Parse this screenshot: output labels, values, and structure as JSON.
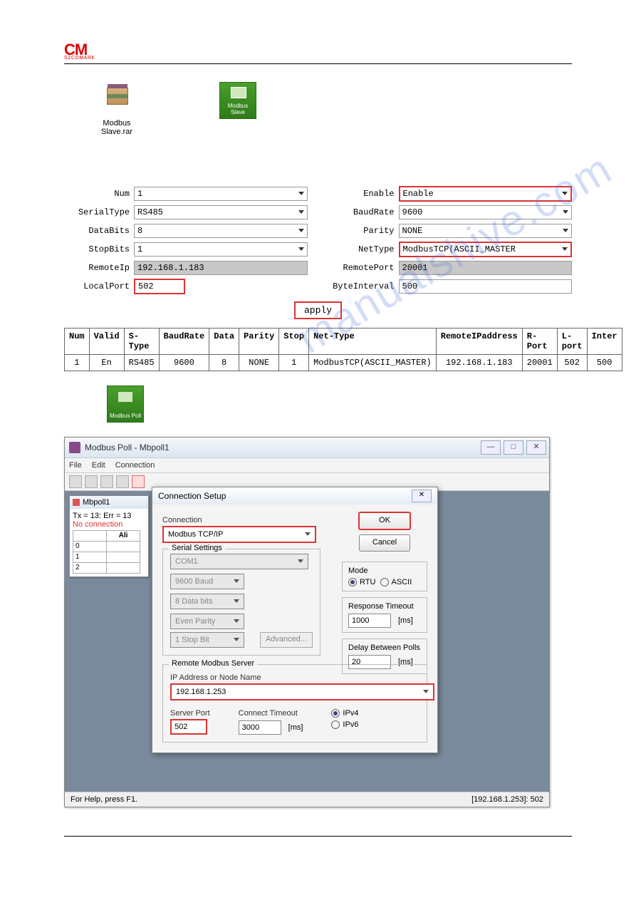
{
  "logo": {
    "top": "CM",
    "sub": "SZCOMARK"
  },
  "watermark": "manualshive.com",
  "desktop": {
    "rar_label_1": "Modbus",
    "rar_label_2": "Slave.rar",
    "slave_tile": "Modbus Slave",
    "poll_tile": "Modbus Poll"
  },
  "form": {
    "left": {
      "num_label": "Num",
      "num_value": "1",
      "serialtype_label": "SerialType",
      "serialtype_value": "RS485",
      "databits_label": "DataBits",
      "databits_value": "8",
      "stopbits_label": "StopBits",
      "stopbits_value": "1",
      "remoteip_label": "RemoteIp",
      "remoteip_value": "192.168.1.183",
      "localport_label": "LocalPort",
      "localport_value": "502"
    },
    "right": {
      "enable_label": "Enable",
      "enable_value": "Enable",
      "baudrate_label": "BaudRate",
      "baudrate_value": "9600",
      "parity_label": "Parity",
      "parity_value": "NONE",
      "nettype_label": "NetType",
      "nettype_value": "ModbusTCP(ASCII_MASTER",
      "remoteport_label": "RemotePort",
      "remoteport_value": "20001",
      "byteinterval_label": "ByteInterval",
      "byteinterval_value": "500"
    },
    "apply": "apply"
  },
  "table": {
    "headers": {
      "num": "Num",
      "valid": "Valid",
      "stype": "S-Type",
      "baud": "BaudRate",
      "data": "Data",
      "parity": "Parity",
      "stop": "Stop",
      "nettype": "Net-Type",
      "rip": "RemoteIPaddress",
      "rport": "R-Port",
      "lport": "L-port",
      "inter": "Inter"
    },
    "row": {
      "num": "1",
      "valid": "En",
      "stype": "RS485",
      "baud": "9600",
      "data": "8",
      "parity": "NONE",
      "stop": "1",
      "nettype": "ModbusTCP(ASCII_MASTER)",
      "rip": "192.168.1.183",
      "rport": "20001",
      "lport": "502",
      "inter": "500"
    }
  },
  "mbpoll": {
    "title": "Modbus Poll - Mbpoll1",
    "menu": {
      "file": "File",
      "edit": "Edit",
      "conn": "Connection"
    },
    "inner_title": "Mbpoll1",
    "tx_err": "Tx = 13: Err = 13",
    "nocon": "No connection",
    "ali": "Ali",
    "rows": [
      "0",
      "1",
      "2"
    ],
    "dialog": {
      "title": "Connection Setup",
      "conn_label": "Connection",
      "conn_value": "Modbus TCP/IP",
      "serial_label": "Serial Settings",
      "com": "COM1",
      "baud": "9600 Baud",
      "data": "8 Data bits",
      "parity": "Even Parity",
      "stop": "1 Stop Bit",
      "advanced": "Advanced...",
      "mode_label": "Mode",
      "mode_rtu": "RTU",
      "mode_ascii": "ASCII",
      "resp_label": "Response Timeout",
      "resp_value": "1000",
      "ms": "[ms]",
      "delay_label": "Delay Between Polls",
      "delay_value": "20",
      "remote_legend": "Remote Modbus Server",
      "ip_label": "IP Address or Node Name",
      "ip_value": "192.168.1.253",
      "sport_label": "Server Port",
      "sport_value": "502",
      "cto_label": "Connect Timeout",
      "cto_value": "3000",
      "ipv4": "IPv4",
      "ipv6": "IPv6",
      "ok": "OK",
      "cancel": "Cancel"
    },
    "status_left": "For Help, press F1.",
    "status_right": "[192.168.1.253]: 502"
  }
}
